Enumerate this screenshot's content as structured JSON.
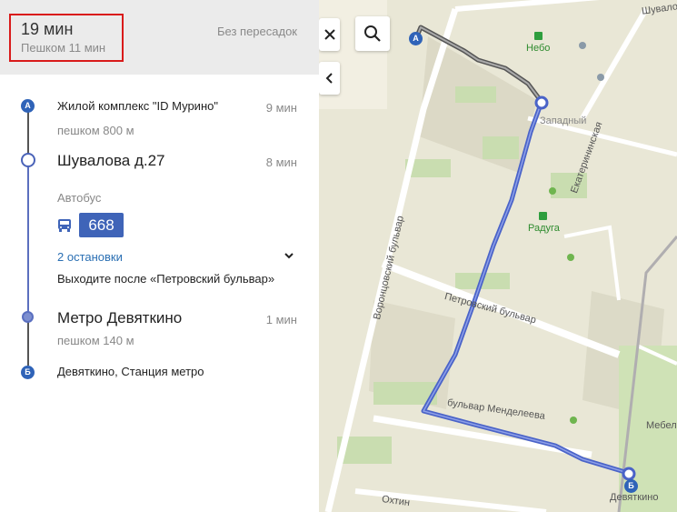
{
  "summary": {
    "time": "19 мин",
    "walk": "Пешком 11 мин",
    "transfers": "Без пересадок"
  },
  "steps": {
    "start": {
      "marker": "А",
      "name": "Жилой комплекс \"ID Мурино\"",
      "duration": "9 мин",
      "walk": "пешком 800 м"
    },
    "stop1": {
      "name": "Шувалова д.27",
      "duration": "8 мин",
      "transport_type": "Автобус",
      "route": "668",
      "stops_link": "2 остановки",
      "exit_hint": "Выходите после «Петровский бульвар»"
    },
    "stop2": {
      "name": "Метро Девяткино",
      "duration": "1 мин",
      "walk": "пешком 140 м"
    },
    "end": {
      "marker": "Б",
      "name": "Девяткино, Станция метро"
    }
  },
  "map": {
    "labels": {
      "shuvalova": "Шувало",
      "nebo": "Небо",
      "zapadny": "Западный",
      "ekaterininskaya": "Екатерининская",
      "raduga": "Радуга",
      "vorontsovsky": "Воронцовский бульвар",
      "petrovsky": "Петровский бульвар",
      "mendeleeva": "бульвар Менделеева",
      "okhtinskaya": "Охтин",
      "mebel": "Мебел",
      "devyatkino": "Девяткино",
      "marker_a": "А",
      "marker_b": "Б"
    }
  },
  "colors": {
    "route": "#4a63c8",
    "walk": "#666666",
    "highlight": "#d91a1a",
    "marker": "#2f63b8"
  }
}
